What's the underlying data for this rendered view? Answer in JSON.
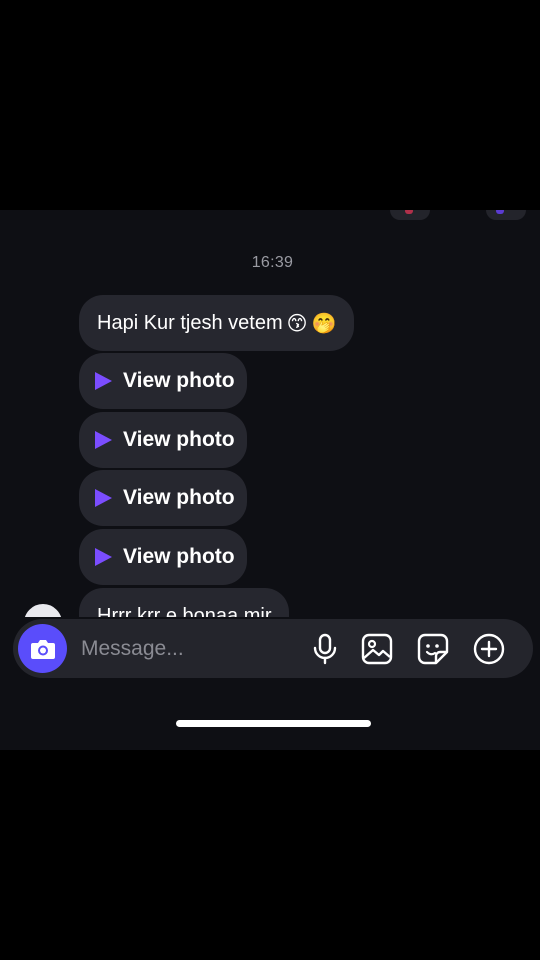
{
  "thread": {
    "timestamp": "16:39",
    "messages": [
      {
        "type": "text",
        "text": "Hapi Kur tjesh vetem",
        "emojis": [
          "😙",
          "🤭"
        ]
      },
      {
        "type": "photo",
        "label": "View photo"
      },
      {
        "type": "photo",
        "label": "View photo"
      },
      {
        "type": "photo",
        "label": "View photo"
      },
      {
        "type": "photo",
        "label": "View photo"
      },
      {
        "type": "text",
        "text": "Hrrr krr e bonaa mir"
      }
    ]
  },
  "composer": {
    "placeholder": "Message...",
    "icons": [
      "camera-icon",
      "microphone-icon",
      "gallery-icon",
      "sticker-icon",
      "plus-circle-icon"
    ],
    "camera_color": "#5a4dfb"
  },
  "colors": {
    "background": "#0e0f14",
    "bubble": "#26272f",
    "accent": "#7b4dff"
  }
}
